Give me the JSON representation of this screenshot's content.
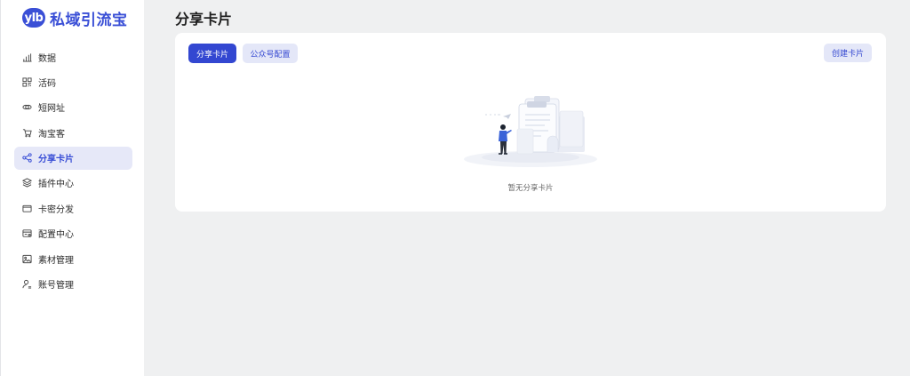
{
  "brand": {
    "badge": "ylb",
    "name": "私域引流宝"
  },
  "sidebar": {
    "items": [
      {
        "label": "数据",
        "icon": "bar-chart-icon"
      },
      {
        "label": "活码",
        "icon": "qr-grid-icon"
      },
      {
        "label": "短网址",
        "icon": "link-icon"
      },
      {
        "label": "淘宝客",
        "icon": "cart-icon"
      },
      {
        "label": "分享卡片",
        "icon": "share-icon",
        "active": true
      },
      {
        "label": "插件中心",
        "icon": "layers-icon"
      },
      {
        "label": "卡密分发",
        "icon": "wallet-icon"
      },
      {
        "label": "配置中心",
        "icon": "settings-card-icon"
      },
      {
        "label": "素材管理",
        "icon": "image-icon"
      },
      {
        "label": "账号管理",
        "icon": "user-icon"
      }
    ]
  },
  "page": {
    "title": "分享卡片"
  },
  "tabs": [
    {
      "label": "分享卡片",
      "active": true
    },
    {
      "label": "公众号配置",
      "active": false
    }
  ],
  "actions": {
    "create_label": "创建卡片"
  },
  "empty_state": {
    "text": "暂无分享卡片"
  },
  "colors": {
    "accent": "#3347d1",
    "accent_light": "#e4e7f8",
    "bg": "#eff0f1"
  }
}
